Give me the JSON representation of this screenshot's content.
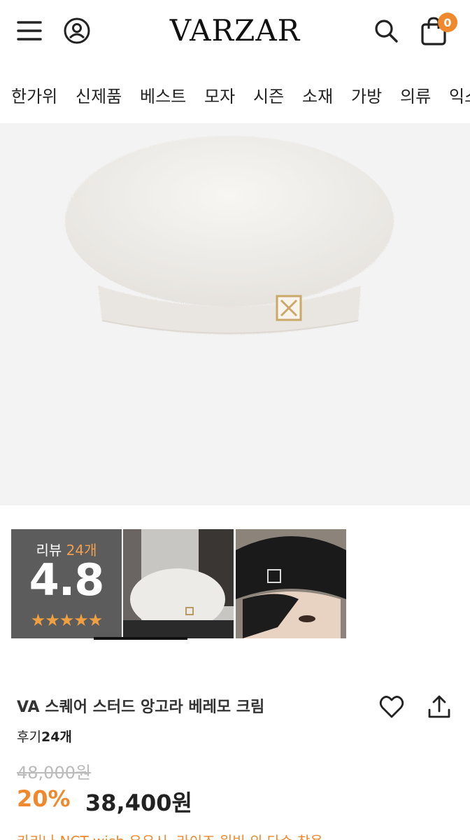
{
  "header": {
    "logo": "VARZAR",
    "cart_count": "0",
    "icons": [
      "menu-icon",
      "user-icon",
      "search-icon",
      "shopping-bag-icon"
    ]
  },
  "categories": [
    "한가위",
    "신제품",
    "베스트",
    "모자",
    "시즌",
    "소재",
    "가방",
    "의류",
    "익스"
  ],
  "product": {
    "title": "VA 스퀘어 스터드 앙고라 베레모 크림",
    "review_prefix": "후기",
    "review_count": "24개",
    "original_price": "48,000원",
    "discount": "20%",
    "sale_price": "38,400원",
    "promo": "카리나 NCT wish 유우시, 라이즈 원빈 외 다수 착용"
  },
  "review_summary": {
    "label": "리뷰 ",
    "count": "24개",
    "score": "4.8",
    "stars": "★★★★★"
  },
  "colors": {
    "accent": "#f0892e",
    "image_bg": "#f3f3f3",
    "review_box": "#5c5c5c"
  }
}
